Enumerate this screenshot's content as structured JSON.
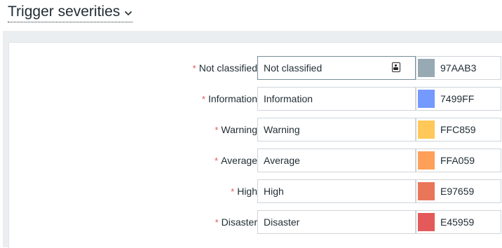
{
  "header": {
    "title": "Trigger severities"
  },
  "severities": [
    {
      "label": "Not classified",
      "value": "Not classified",
      "color": "97AAB3",
      "hex": "#97AAB3"
    },
    {
      "label": "Information",
      "value": "Information",
      "color": "7499FF",
      "hex": "#7499FF"
    },
    {
      "label": "Warning",
      "value": "Warning",
      "color": "FFC859",
      "hex": "#FFC859"
    },
    {
      "label": "Average",
      "value": "Average",
      "color": "FFA059",
      "hex": "#FFA059"
    },
    {
      "label": "High",
      "value": "High",
      "color": "E97659",
      "hex": "#E97659"
    },
    {
      "label": "Disaster",
      "value": "Disaster",
      "color": "E45959",
      "hex": "#E45959"
    }
  ],
  "required_marker": "*"
}
